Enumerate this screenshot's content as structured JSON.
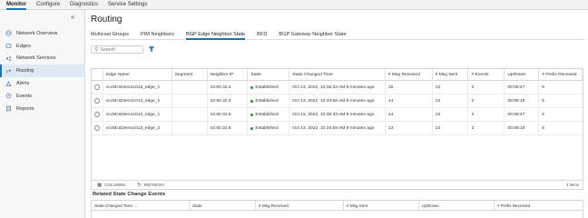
{
  "topnav": [
    "Monitor",
    "Configure",
    "Diagnostics",
    "Service Settings"
  ],
  "sidebar": {
    "collapse_glyph": "«",
    "items": [
      {
        "label": "Network Overview",
        "icon": "network-icon"
      },
      {
        "label": "Edges",
        "icon": "edge-icon"
      },
      {
        "label": "Network Services",
        "icon": "services-icon"
      },
      {
        "label": "Routing",
        "icon": "routing-icon"
      },
      {
        "label": "Alerts",
        "icon": "alert-icon"
      },
      {
        "label": "Events",
        "icon": "events-icon"
      },
      {
        "label": "Reports",
        "icon": "reports-icon"
      }
    ]
  },
  "page": {
    "title": "Routing",
    "tabs": [
      "Multicast Groups",
      "PIM Neighbors",
      "BGP Edge Neighbor State",
      "BFD",
      "BGP Gateway Neighbor State"
    ],
    "search_placeholder": "Search"
  },
  "grid": {
    "headers": [
      "Edge Name",
      "Segment",
      "Neighbor IP",
      "State",
      "State Changed Time",
      "# Msg Received",
      "# Msg Sent",
      "# Events",
      "Up/Down",
      "# Prefix Received"
    ],
    "rows": [
      [
        "vccMcsDemo1013_edge_1",
        "",
        "10.50.32.4",
        "Established",
        "Oct 13, 2022, 10:35:33 AM 8 minutes ago",
        "15",
        "13",
        "2",
        "00:08:47",
        "5"
      ],
      [
        "vccMcsDemo1013_edge_2",
        "",
        "10.50.32.4",
        "Established",
        "Oct 13, 2022, 10:34:58 AM 9 minutes ago",
        "14",
        "13",
        "2",
        "00:08:15",
        "5"
      ],
      [
        "vccMcsDemo1013_edge_1",
        "",
        "10.50.32.5",
        "Established",
        "Oct 13, 2022, 10:35:33 AM 8 minutes ago",
        "14",
        "13",
        "2",
        "00:08:47",
        "5"
      ],
      [
        "vccMcsDemo1013_edge_2",
        "",
        "10.50.32.5",
        "Established",
        "Oct 13, 2022, 10:34:58 AM 9 minutes ago",
        "13",
        "13",
        "2",
        "00:08:15",
        "5"
      ]
    ],
    "footer": {
      "columns": "COLUMNS",
      "refresh": "REFRESH",
      "items": "4 items"
    }
  },
  "events": {
    "title": "Related State Change Events",
    "headers": [
      "State Changed Time",
      "State",
      "# Msg Received",
      "# Msg Sent",
      "Up/Down",
      "# Prefix Received"
    ]
  },
  "colors": {
    "accent": "#1a73b5",
    "established": "#2f8a3a"
  }
}
